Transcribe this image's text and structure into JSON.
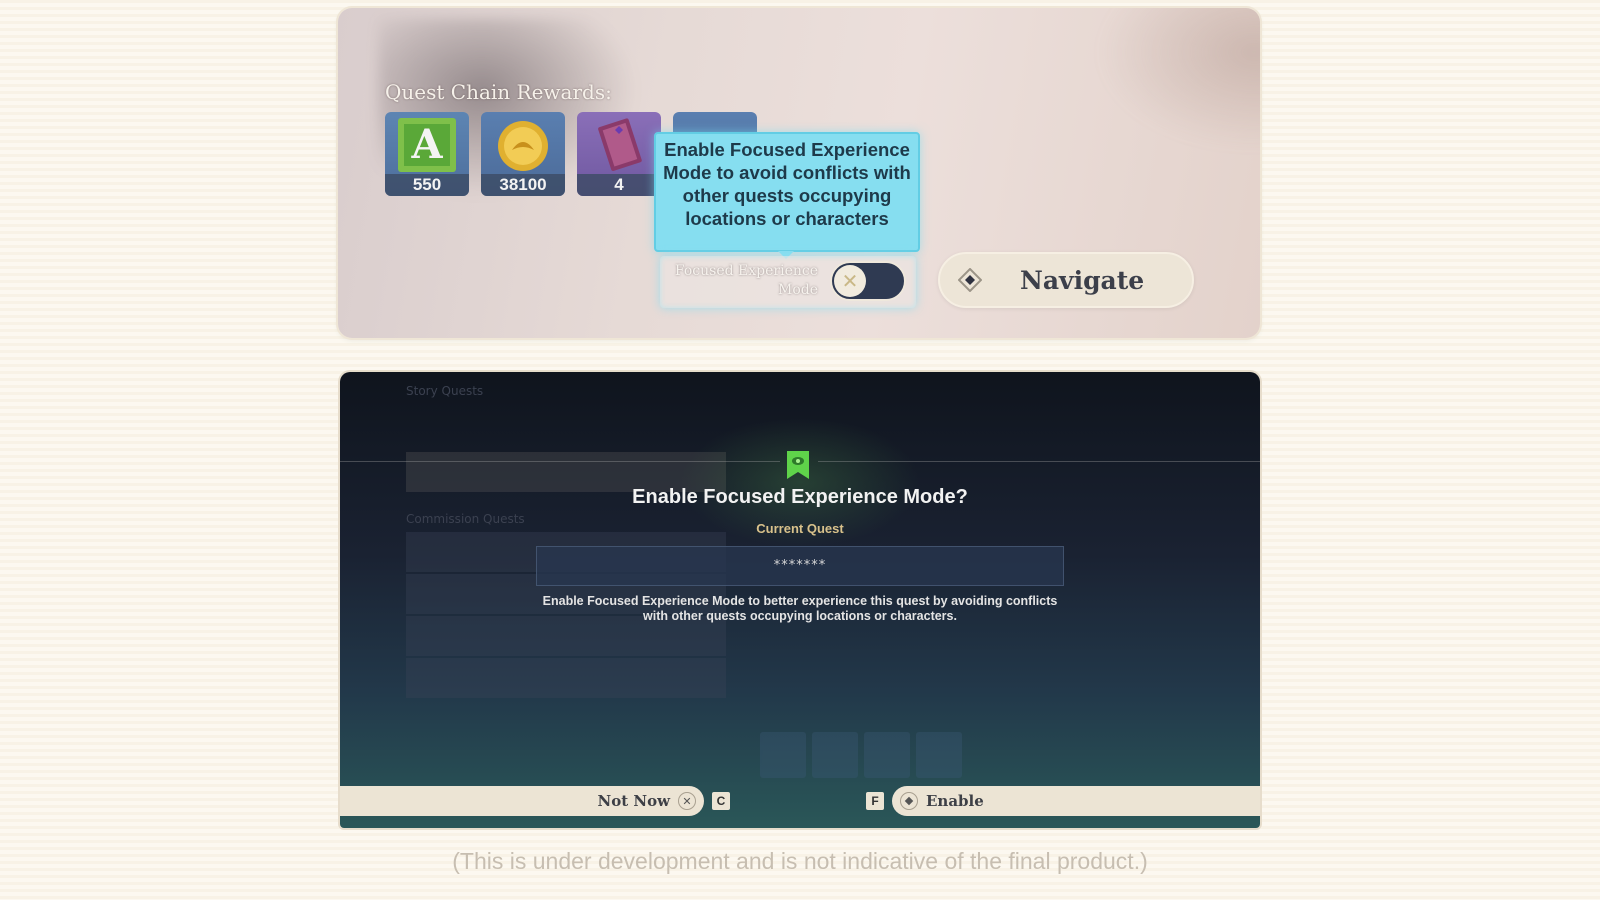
{
  "quest_panel": {
    "rewards_title": "Quest Chain Rewards:",
    "rewards": [
      {
        "icon": "adventure-exp-icon",
        "count": "550"
      },
      {
        "icon": "mora-coin-icon",
        "count": "38100"
      },
      {
        "icon": "heros-wit-book-icon",
        "count": "4"
      },
      {
        "icon": "reward-item-icon",
        "count": ""
      }
    ],
    "tooltip_text": "Enable Focused Experience Mode to avoid conflicts with other quests occupying locations or characters",
    "focus_mode_label": "Focused Experience Mode",
    "focus_mode_enabled": false,
    "navigate_label": "Navigate"
  },
  "dialog": {
    "background_list_title": "Story Quests",
    "background_list_section": "Commission Quests",
    "title": "Enable Focused Experience Mode?",
    "current_quest_label": "Current Quest",
    "current_quest_value": "*******",
    "description": "Enable Focused Experience Mode to better experience this quest by avoiding conflicts with other quests occupying locations or characters.",
    "not_now_label": "Not Now",
    "not_now_key": "C",
    "enable_key": "F",
    "enable_label": "Enable"
  },
  "disclaimer": "(This is under development and is not indicative of the final product.)",
  "colors": {
    "tooltip_bg": "#86def0",
    "toggle_track": "#2f3a52",
    "banner_green": "#5fd34a",
    "current_quest_gold": "#d8c18b"
  }
}
